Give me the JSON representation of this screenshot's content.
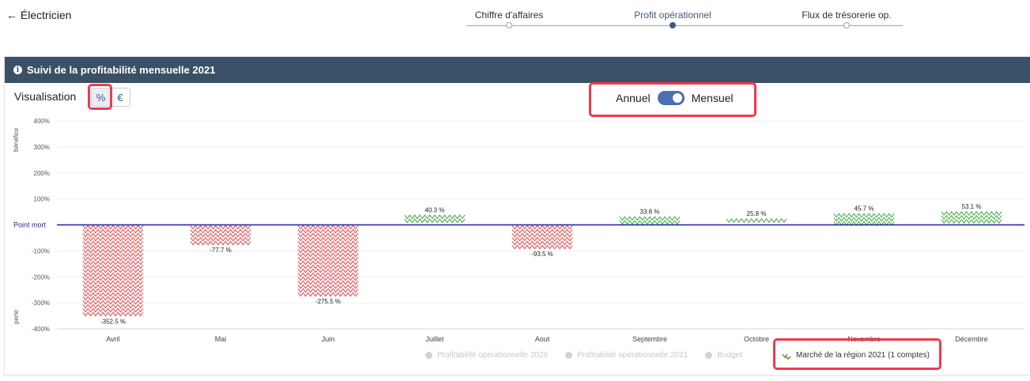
{
  "header": {
    "back_label": "← Électricien"
  },
  "stepper": {
    "steps": [
      {
        "label": "Chiffre d'affaires"
      },
      {
        "label": "Profit opérationnel"
      },
      {
        "label": "Flux de trésorerie op."
      }
    ],
    "active_index": 1
  },
  "card": {
    "title": "Suivi de la profitabilité mensuelle 2021",
    "visualisation_label": "Visualisation",
    "unit_options": [
      "%",
      "€"
    ],
    "selected_unit": "%",
    "toggle": {
      "left_label": "Annuel",
      "right_label": "Mensuel",
      "state": "Mensuel"
    }
  },
  "colors": {
    "header_bg": "#3a5066",
    "negative": "#e8545a",
    "positive": "#4cb34c",
    "breakeven_line": "#1d1d9e",
    "highlight": "#f2384c",
    "toggle": "#4b6fb0"
  },
  "chart_data": {
    "type": "bar",
    "categories": [
      "Avril",
      "Mai",
      "Juin",
      "Juillet",
      "Aout",
      "Septembre",
      "Octobre",
      "Novembre",
      "Décembre"
    ],
    "series": [
      {
        "name": "Marché de la région 2021 (1 comptes)",
        "values": [
          -352.5,
          -77.7,
          -275.5,
          40.3,
          -93.5,
          33.8,
          25.8,
          45.7,
          53.1
        ],
        "value_labels": [
          "-352.5 %",
          "-77.7 %",
          "-275.5 %",
          "40.3 %",
          "-93.5 %",
          "33.8 %",
          "25.8 %",
          "45.7 %",
          "53.1 %"
        ]
      }
    ],
    "ylim": [
      -400,
      400
    ],
    "y_ticks": [
      400,
      300,
      200,
      100,
      0,
      -100,
      -200,
      -300,
      -400
    ],
    "y_tick_labels": [
      "400%",
      "300%",
      "200%",
      "100%",
      "",
      "-100%",
      "-200%",
      "-300%",
      "-400%"
    ],
    "breakeven_label": "Point mort",
    "ylabel_top": "bénéfice",
    "ylabel_bottom": "perte",
    "grid": true,
    "legend": [
      {
        "name": "Profitabilité opérationnelle 2020",
        "active": false
      },
      {
        "name": "Profitabilité opérationnelle 2021",
        "active": false
      },
      {
        "name": "Budget",
        "active": false
      },
      {
        "name": "Marché de la région 2021 (1 comptes)",
        "active": true
      }
    ],
    "legend_position": "bottom"
  }
}
